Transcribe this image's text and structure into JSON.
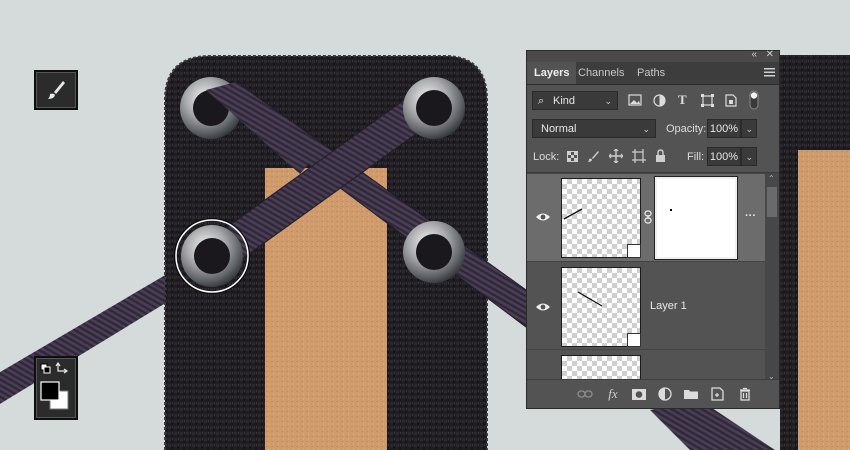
{
  "panel": {
    "tabs": [
      {
        "label": "Layers",
        "active": true
      },
      {
        "label": "Channels",
        "active": false
      },
      {
        "label": "Paths",
        "active": false
      }
    ],
    "filter": {
      "kind_label": "Kind"
    },
    "blend_mode": "Normal",
    "opacity_label": "Opacity:",
    "opacity_value": "100%",
    "lock_label": "Lock:",
    "fill_label": "Fill:",
    "fill_value": "100%",
    "layers": [
      {
        "name": "",
        "selected": true,
        "has_mask": true
      },
      {
        "name": "Layer 1",
        "selected": false,
        "has_mask": false
      },
      {
        "name": "",
        "selected": false,
        "has_mask": false
      }
    ]
  },
  "icons": {
    "filter_glyphs": [
      "image-filter-icon",
      "adjustment-filter-icon",
      "type-filter-icon",
      "shape-filter-icon",
      "smart-object-filter-icon",
      "filter-toggle-icon"
    ],
    "lock_glyphs": [
      "lock-transparent-icon",
      "lock-pixels-icon",
      "lock-position-icon",
      "lock-artboard-icon",
      "lock-all-icon"
    ],
    "bottom_glyphs": [
      "link-layers-icon",
      "fx-icon",
      "add-mask-icon",
      "adjustment-layer-icon",
      "new-group-icon",
      "new-layer-icon",
      "delete-layer-icon"
    ],
    "fx_text": "fx"
  },
  "colors": {
    "panel_bg": "#535353",
    "selected_row": "#6c6c6c",
    "canvas_bg": "#d5dbdb",
    "fabric": "#1e1c1f",
    "kraft": "#cf9b6c",
    "lace": "#3c3245"
  }
}
